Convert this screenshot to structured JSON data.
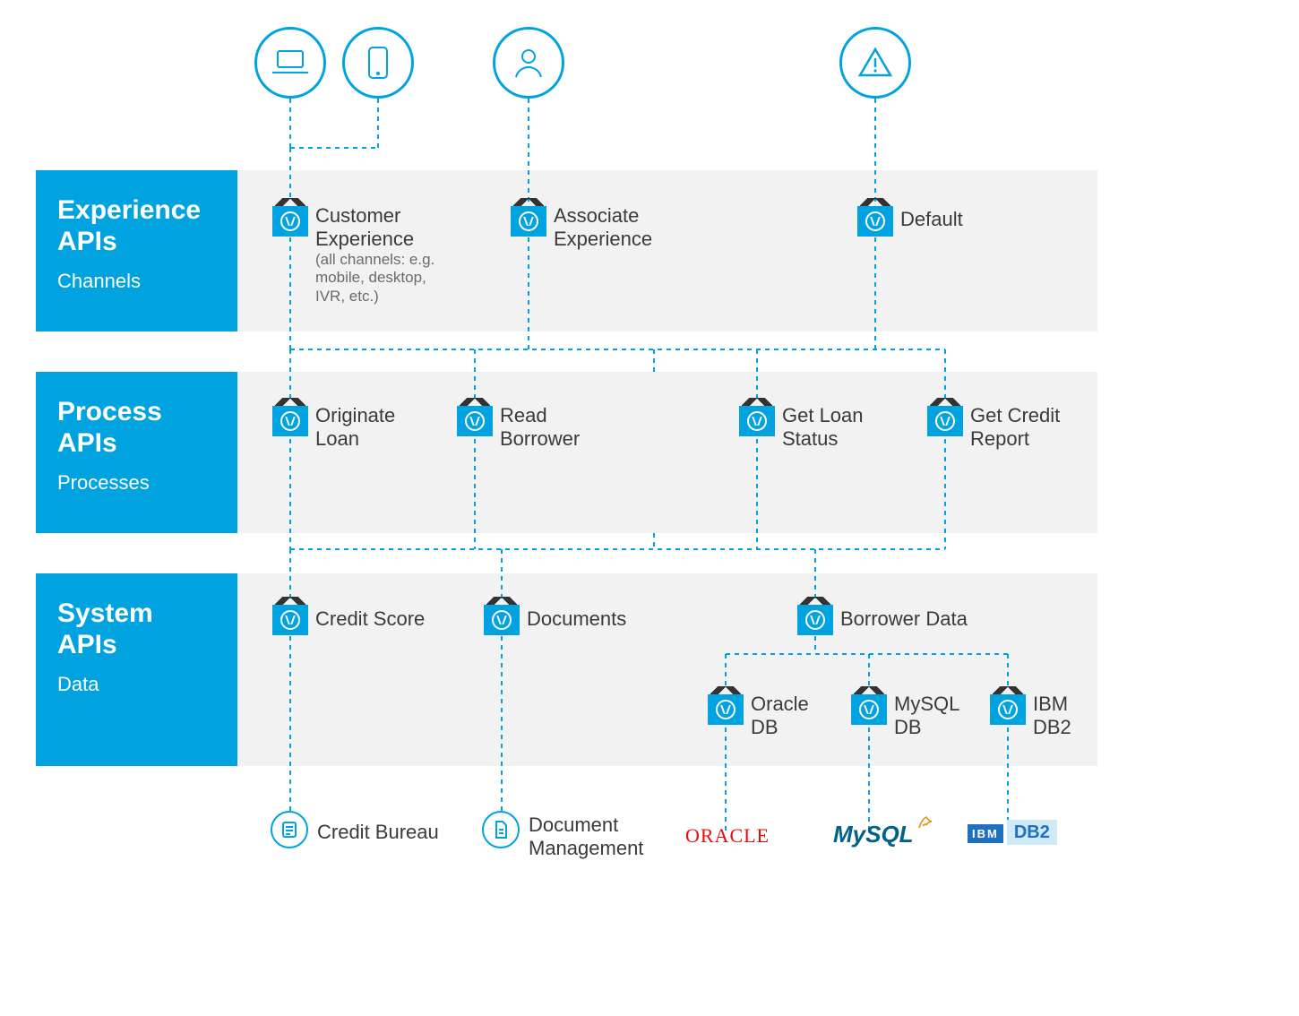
{
  "layers": {
    "experience": {
      "title": "Experience APIs",
      "subtitle": "Channels"
    },
    "process": {
      "title": "Process APIs",
      "subtitle": "Processes"
    },
    "system": {
      "title": "System APIs",
      "subtitle": "Data"
    }
  },
  "channelIcons": {
    "laptop": "laptop",
    "mobile": "mobile",
    "person": "person",
    "alert": "alert"
  },
  "experienceAPIs": {
    "customer": {
      "label": "Customer Experience",
      "note": "(all channels: e.g. mobile, desktop, IVR, etc.)"
    },
    "associate": {
      "label": "Associate Experience"
    },
    "default": {
      "label": "Default"
    }
  },
  "processAPIs": {
    "originate": {
      "label": "Originate Loan"
    },
    "readBorrower": {
      "label": "Read Borrower"
    },
    "loanStatus": {
      "label": "Get Loan Status"
    },
    "creditReport": {
      "label": "Get Credit Report"
    }
  },
  "systemAPIs": {
    "creditScore": {
      "label": "Credit Score"
    },
    "documents": {
      "label": "Documents"
    },
    "borrowerData": {
      "label": "Borrower Data"
    },
    "oracleDB": {
      "label": "Oracle DB"
    },
    "mysqlDB": {
      "label": "MySQL DB"
    },
    "ibmDB2": {
      "label": "IBM DB2"
    }
  },
  "dataSources": {
    "creditBureau": {
      "label": "Credit Bureau"
    },
    "docMgmt": {
      "label": "Document Management"
    },
    "oracle": {
      "label": "ORACLE"
    },
    "mysql": {
      "label": "MySQL"
    },
    "db2": {
      "ibm": "IBM",
      "label": "DB2"
    }
  }
}
